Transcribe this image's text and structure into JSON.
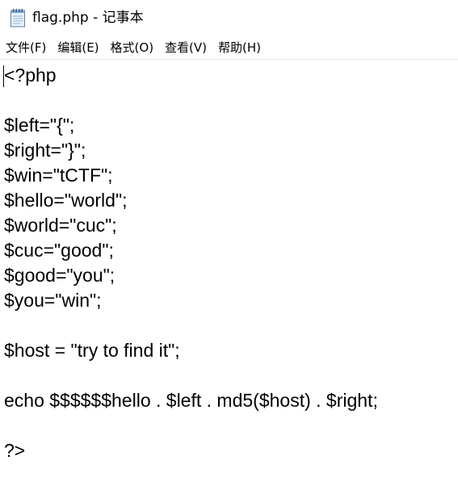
{
  "window": {
    "title": "flag.php - 记事本",
    "icon": "notepad-icon"
  },
  "menu": [
    {
      "key": "file",
      "label": "文件(F)"
    },
    {
      "key": "edit",
      "label": "编辑(E)"
    },
    {
      "key": "format",
      "label": "格式(O)"
    },
    {
      "key": "view",
      "label": "查看(V)"
    },
    {
      "key": "help",
      "label": "帮助(H)"
    }
  ],
  "editor": {
    "lines": [
      "<?php",
      "",
      "$left=\"{\";",
      "$right=\"}\";",
      "$win=\"tCTF\";",
      "$hello=\"world\";",
      "$world=\"cuc\";",
      "$cuc=\"good\";",
      "$good=\"you\";",
      "$you=\"win\";",
      "",
      "$host = \"try to find it\";",
      "",
      "echo $$$$$$hello . $left . md5($host) . $right;",
      "",
      "?>"
    ]
  }
}
